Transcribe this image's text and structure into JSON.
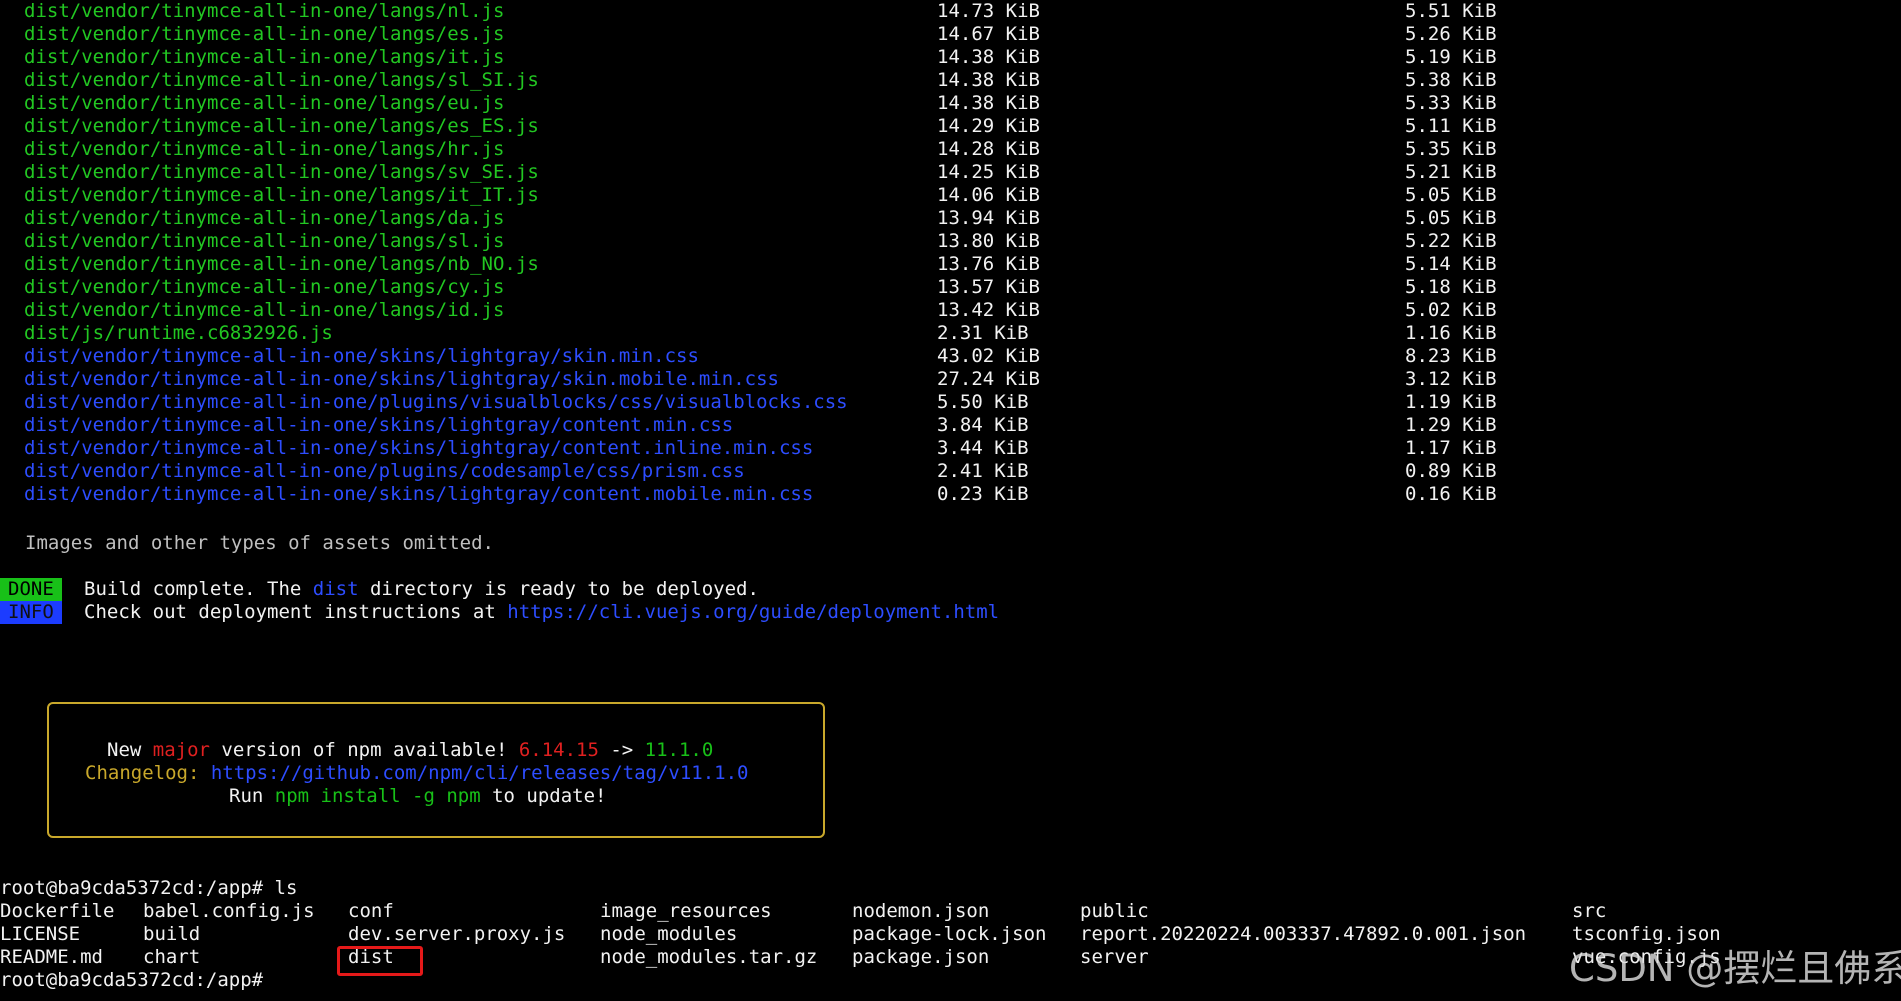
{
  "asset_rows": [
    {
      "file": "dist/vendor/tinymce-all-in-one/langs/nl.js",
      "size": "14.73 KiB",
      "gzipped": "5.51 KiB",
      "color": "green"
    },
    {
      "file": "dist/vendor/tinymce-all-in-one/langs/es.js",
      "size": "14.67 KiB",
      "gzipped": "5.26 KiB",
      "color": "green"
    },
    {
      "file": "dist/vendor/tinymce-all-in-one/langs/it.js",
      "size": "14.38 KiB",
      "gzipped": "5.19 KiB",
      "color": "green"
    },
    {
      "file": "dist/vendor/tinymce-all-in-one/langs/sl_SI.js",
      "size": "14.38 KiB",
      "gzipped": "5.38 KiB",
      "color": "green"
    },
    {
      "file": "dist/vendor/tinymce-all-in-one/langs/eu.js",
      "size": "14.38 KiB",
      "gzipped": "5.33 KiB",
      "color": "green"
    },
    {
      "file": "dist/vendor/tinymce-all-in-one/langs/es_ES.js",
      "size": "14.29 KiB",
      "gzipped": "5.11 KiB",
      "color": "green"
    },
    {
      "file": "dist/vendor/tinymce-all-in-one/langs/hr.js",
      "size": "14.28 KiB",
      "gzipped": "5.35 KiB",
      "color": "green"
    },
    {
      "file": "dist/vendor/tinymce-all-in-one/langs/sv_SE.js",
      "size": "14.25 KiB",
      "gzipped": "5.21 KiB",
      "color": "green"
    },
    {
      "file": "dist/vendor/tinymce-all-in-one/langs/it_IT.js",
      "size": "14.06 KiB",
      "gzipped": "5.05 KiB",
      "color": "green"
    },
    {
      "file": "dist/vendor/tinymce-all-in-one/langs/da.js",
      "size": "13.94 KiB",
      "gzipped": "5.05 KiB",
      "color": "green"
    },
    {
      "file": "dist/vendor/tinymce-all-in-one/langs/sl.js",
      "size": "13.80 KiB",
      "gzipped": "5.22 KiB",
      "color": "green"
    },
    {
      "file": "dist/vendor/tinymce-all-in-one/langs/nb_NO.js",
      "size": "13.76 KiB",
      "gzipped": "5.14 KiB",
      "color": "green"
    },
    {
      "file": "dist/vendor/tinymce-all-in-one/langs/cy.js",
      "size": "13.57 KiB",
      "gzipped": "5.18 KiB",
      "color": "green"
    },
    {
      "file": "dist/vendor/tinymce-all-in-one/langs/id.js",
      "size": "13.42 KiB",
      "gzipped": "5.02 KiB",
      "color": "green"
    },
    {
      "file": "dist/js/runtime.c6832926.js",
      "size": "2.31 KiB",
      "gzipped": "1.16 KiB",
      "color": "green"
    },
    {
      "file": "dist/vendor/tinymce-all-in-one/skins/lightgray/skin.min.css",
      "size": "43.02 KiB",
      "gzipped": "8.23 KiB",
      "color": "blue"
    },
    {
      "file": "dist/vendor/tinymce-all-in-one/skins/lightgray/skin.mobile.min.css",
      "size": "27.24 KiB",
      "gzipped": "3.12 KiB",
      "color": "blue"
    },
    {
      "file": "dist/vendor/tinymce-all-in-one/plugins/visualblocks/css/visualblocks.css",
      "size": "5.50 KiB",
      "gzipped": "1.19 KiB",
      "color": "blue"
    },
    {
      "file": "dist/vendor/tinymce-all-in-one/skins/lightgray/content.min.css",
      "size": "3.84 KiB",
      "gzipped": "1.29 KiB",
      "color": "blue"
    },
    {
      "file": "dist/vendor/tinymce-all-in-one/skins/lightgray/content.inline.min.css",
      "size": "3.44 KiB",
      "gzipped": "1.17 KiB",
      "color": "blue"
    },
    {
      "file": "dist/vendor/tinymce-all-in-one/plugins/codesample/css/prism.css",
      "size": "2.41 KiB",
      "gzipped": "0.89 KiB",
      "color": "blue"
    },
    {
      "file": "dist/vendor/tinymce-all-in-one/skins/lightgray/content.mobile.min.css",
      "size": "0.23 KiB",
      "gzipped": "0.16 KiB",
      "color": "blue"
    }
  ],
  "omitted_note": "Images and other types of assets omitted.",
  "done": {
    "badge": "DONE",
    "text_before": "Build complete. The ",
    "dist_word": "dist",
    "text_after": " directory is ready to be deployed."
  },
  "info": {
    "badge": "INFO",
    "text_before": "Check out deployment instructions at ",
    "url": "https://cli.vuejs.org/guide/deployment.html"
  },
  "npm_update": {
    "line1_prefix": "New ",
    "line1_major": "major",
    "line1_middle": " version of npm available! ",
    "line1_old": "6.14.15",
    "line1_arrow": " -> ",
    "line1_new": "11.1.0",
    "line2_label": "Changelog: ",
    "line2_url": "https://github.com/npm/cli/releases/tag/v11.1.0",
    "line3_prefix": "Run ",
    "line3_cmd": "npm install -g npm",
    "line3_suffix": " to update!"
  },
  "prompt": {
    "ps1": "root@ba9cda5372cd:/app#",
    "command": " ls"
  },
  "ls_output": [
    [
      "Dockerfile",
      "babel.config.js",
      "conf",
      "image_resources",
      "nodemon.json",
      "public",
      "src"
    ],
    [
      "LICENSE",
      "build",
      "dev.server.proxy.js",
      "node_modules",
      "package-lock.json",
      "report.20220224.003337.47892.0.001.json",
      "tsconfig.json"
    ],
    [
      "README.md",
      "chart",
      "dist",
      "node_modules.tar.gz",
      "package.json",
      "server",
      "vue.config.js"
    ]
  ],
  "final_prompt": "root@ba9cda5372cd:/app#",
  "watermark": "CSDN @摆烂且佛系",
  "colors": {
    "background": "#000000",
    "green": "#22c722",
    "blue": "#2d4dff",
    "red_highlight": "#e51919",
    "box_border": "#c9a82b"
  }
}
